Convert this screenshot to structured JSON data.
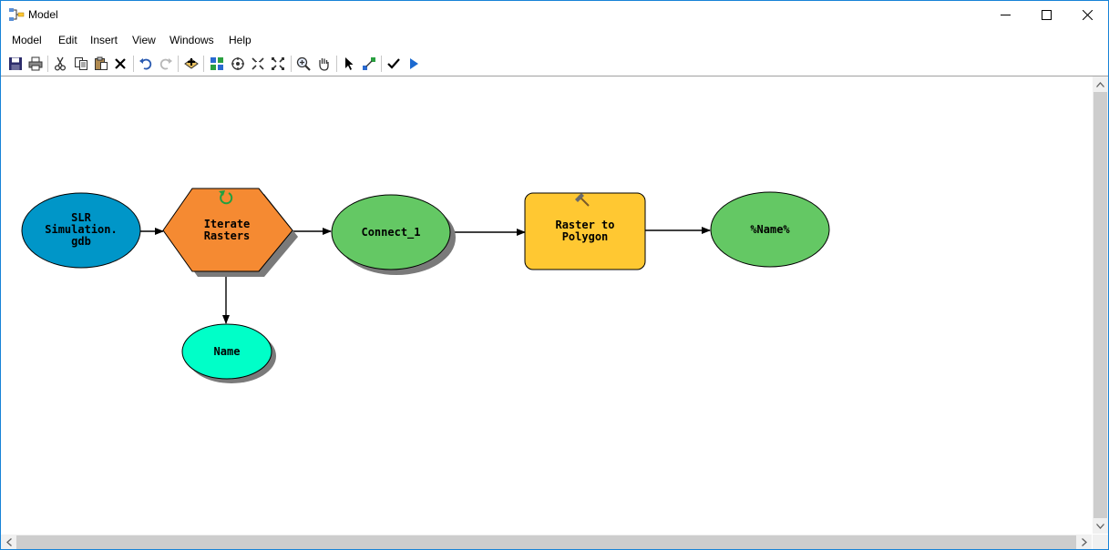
{
  "window": {
    "title": "Model"
  },
  "menu": [
    "Model",
    "Edit",
    "Insert",
    "View",
    "Windows",
    "Help"
  ],
  "toolbar_icons": [
    "save-icon",
    "print-icon",
    "cut-icon",
    "copy-icon",
    "paste-icon",
    "delete-icon",
    "undo-icon",
    "redo-icon",
    "add-data-icon",
    "auto-layout-icon",
    "full-extent-icon",
    "fixed-zoom-in-icon",
    "fixed-zoom-out-icon",
    "zoom-in-icon",
    "pan-icon",
    "select-icon",
    "add-connection-icon",
    "validate-icon",
    "run-icon"
  ],
  "model": {
    "nodes": {
      "slr_gdb": [
        "SLR",
        "Simulation.",
        "gdb"
      ],
      "iterate": [
        "Iterate",
        "Rasters"
      ],
      "connect": [
        "Connect_1"
      ],
      "raster_to_polygon": [
        "Raster to",
        "Polygon"
      ],
      "output": [
        "%Name%"
      ],
      "name": [
        "Name"
      ]
    },
    "colors": {
      "input_data": "#0096c8",
      "iterator": "#f58a32",
      "intermediate": "#64c864",
      "tool": "#ffc832",
      "output": "#64c864",
      "variable": "#00ffc8"
    }
  }
}
